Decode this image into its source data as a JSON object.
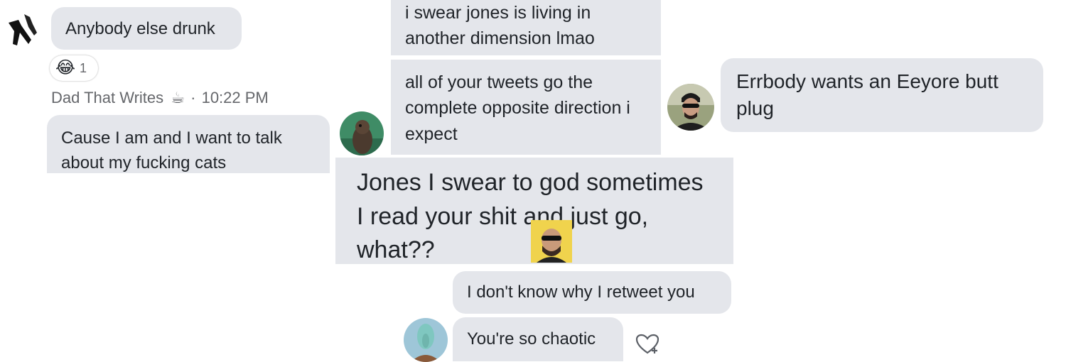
{
  "messages": {
    "anybody": "Anybody else drunk",
    "reaction": {
      "emoji": "😂",
      "count": "1"
    },
    "meta": {
      "name": "Dad That Writes",
      "emoji": "☕",
      "separator": "·",
      "time": "10:22 PM"
    },
    "cause": "Cause I am and I want to talk about my fucking cats",
    "swear_jones": "i swear jones is living in another dimension lmao",
    "tweets": "all of your tweets go the complete opposite direction i expect",
    "jones_god": "Jones I swear to god sometimes I read your shit and just go, what??",
    "errbody": "Errbody wants an Eeyore butt plug",
    "retweet": "I don't know why I retweet you",
    "chaotic": "You're so chaotic"
  },
  "colors": {
    "bubble": "#e4e6eb",
    "meta_text": "#65676b"
  },
  "icons": [
    "crow-avatar",
    "seal-avatar",
    "man-sunglasses-avatar",
    "squidward-avatar",
    "laughing-emoji",
    "coffee-emoji",
    "heart-add-icon"
  ]
}
